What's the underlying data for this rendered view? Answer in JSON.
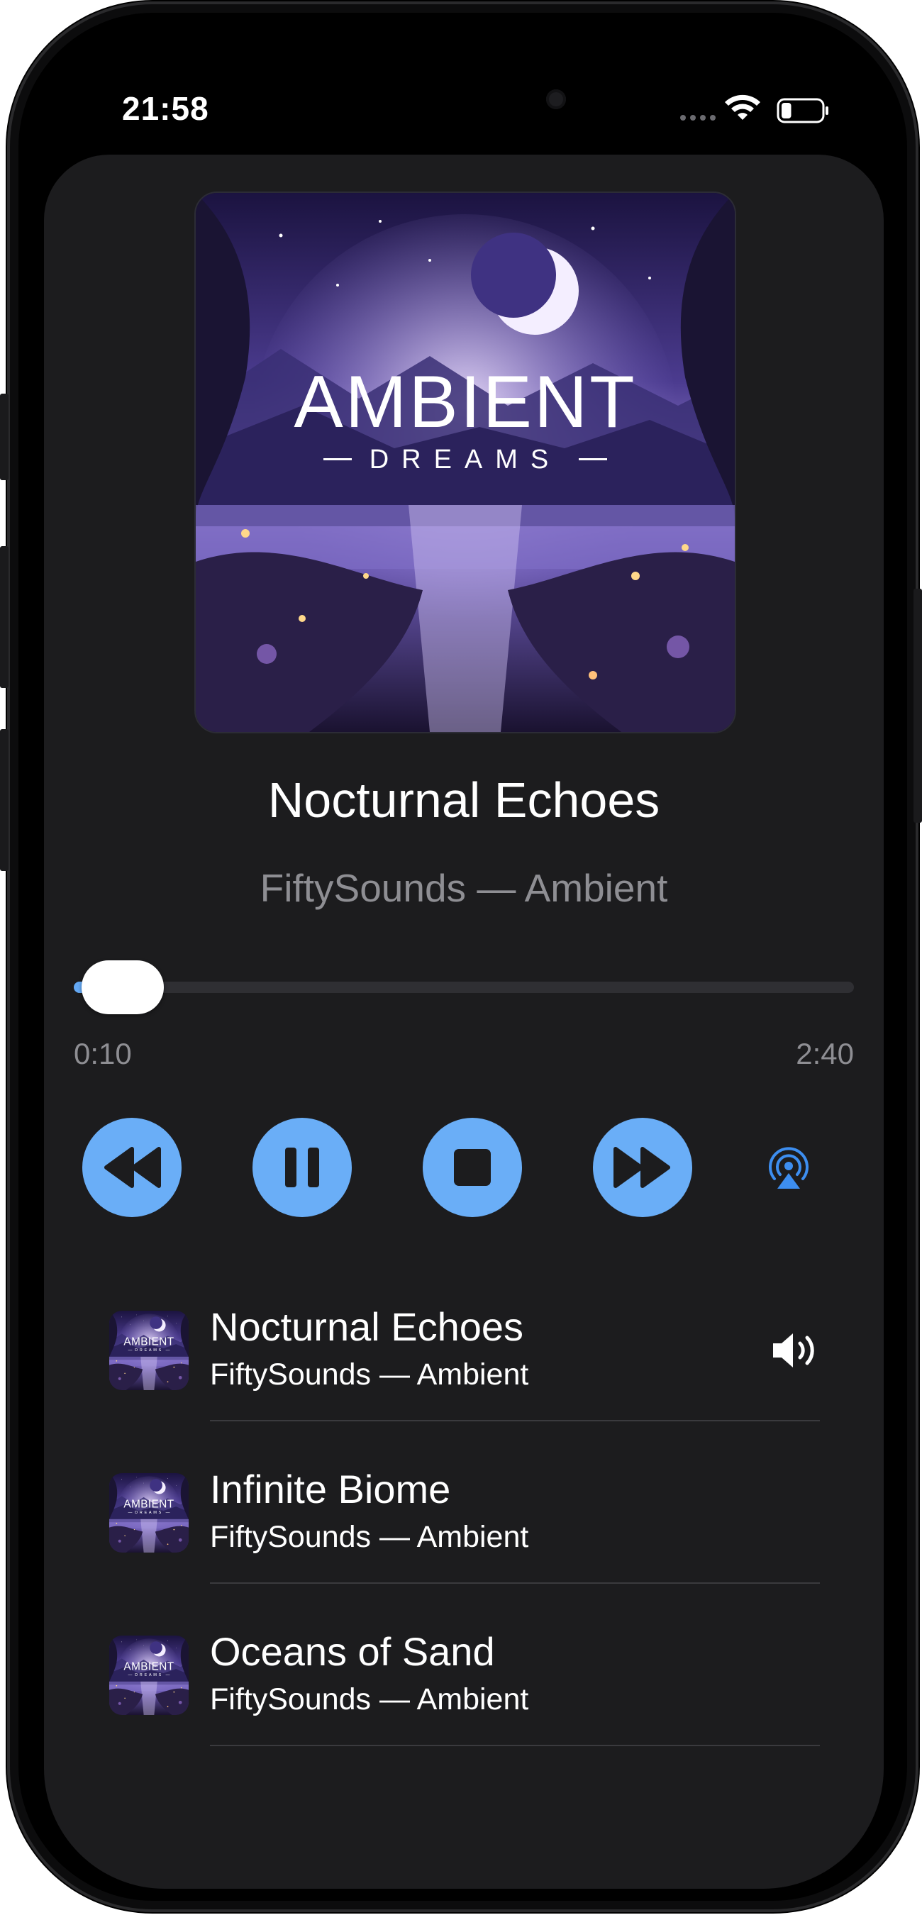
{
  "status_bar": {
    "time": "21:58",
    "icons": [
      "signal-dots-icon",
      "wifi-icon",
      "battery-icon"
    ],
    "battery_level": 0.25
  },
  "now_playing": {
    "artwork": {
      "icon": "album-art-ambient-dreams",
      "title_text": "AMBIENT",
      "subtitle_text": "DREAMS"
    },
    "title": "Nocturnal Echoes",
    "subtitle": "FiftySounds — Ambient",
    "progress": {
      "elapsed": "0:10",
      "total": "2:40",
      "fraction": 0.0625
    }
  },
  "controls": {
    "rewind": "rewind-icon",
    "pause": "pause-icon",
    "stop": "stop-icon",
    "fast_forward": "fast-forward-icon",
    "airplay": "airplay-icon"
  },
  "playlist": [
    {
      "title": "Nocturnal Echoes",
      "subtitle": "FiftySounds — Ambient",
      "playing": true,
      "indicator": "speaker-icon"
    },
    {
      "title": "Infinite Biome",
      "subtitle": "FiftySounds — Ambient",
      "playing": false
    },
    {
      "title": "Oceans of Sand",
      "subtitle": "FiftySounds — Ambient",
      "playing": false
    }
  ],
  "colors": {
    "accent": "#6aaef7",
    "progress_fill": "#64a9f5",
    "airplay": "#3d8ef0",
    "background": "#1c1c1e",
    "secondary_text": "#8e8e93"
  }
}
